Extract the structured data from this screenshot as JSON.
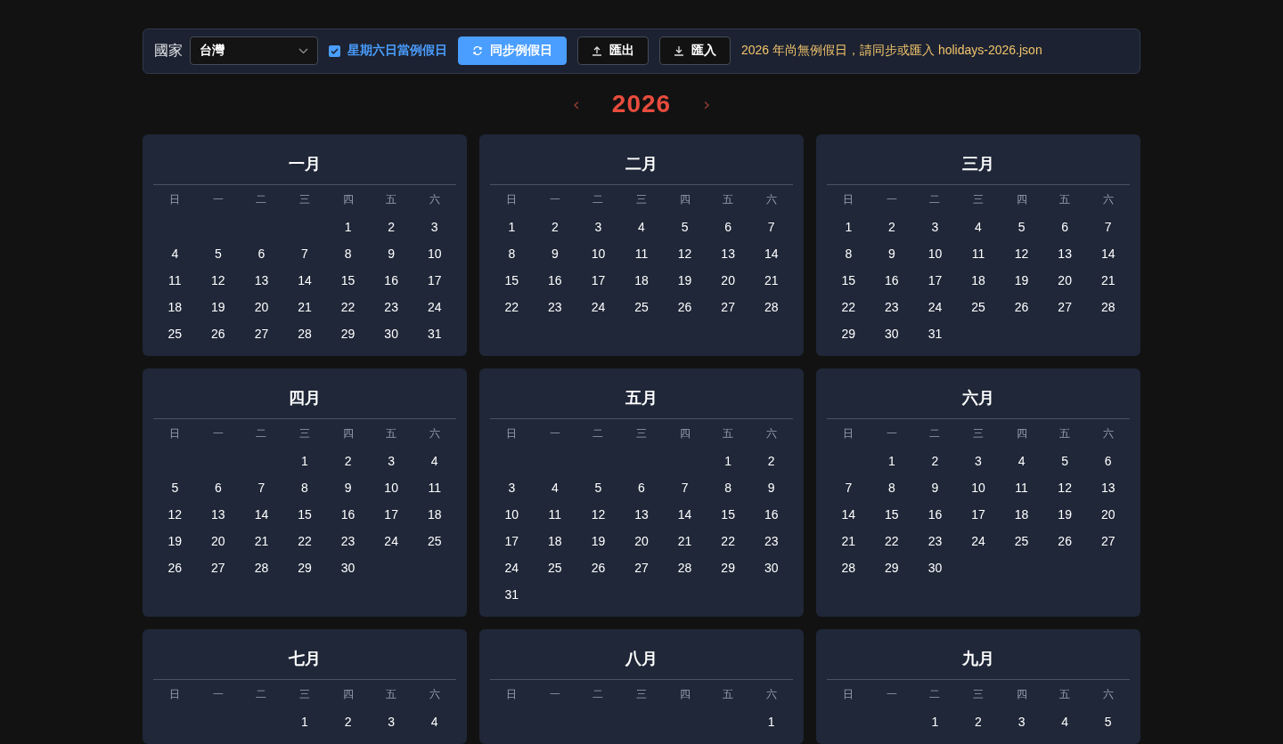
{
  "toolbar": {
    "country_label": "國家",
    "country_select": {
      "value": "台灣"
    },
    "weekend_checkbox": {
      "label": "星期六日當例假日",
      "checked": true
    },
    "buttons": [
      {
        "kind": "sync",
        "label": "同步例假日"
      },
      {
        "kind": "export",
        "label": "匯出"
      },
      {
        "kind": "import",
        "label": "匯入"
      }
    ],
    "notice": "2026 年尚無例假日，請同步或匯入 holidays-2026.json"
  },
  "year_nav": {
    "prev": "‹",
    "year": "2026",
    "next": "›"
  },
  "months": [
    {
      "title": "一月",
      "weekdays": [
        "日",
        "一",
        "二",
        "三",
        "四",
        "五",
        "六"
      ],
      "weeks": [
        {
          "kind": "lead",
          "days": [
            "1",
            "2",
            "3"
          ]
        },
        {
          "kind": "row",
          "days": [
            "4",
            "5",
            "6",
            "7",
            "8",
            "9",
            "10"
          ]
        },
        {
          "kind": "row",
          "days": [
            "11",
            "12",
            "13",
            "14",
            "15",
            "16",
            "17"
          ]
        },
        {
          "kind": "row",
          "days": [
            "18",
            "19",
            "20",
            "21",
            "22",
            "23",
            "24"
          ]
        },
        {
          "kind": "row",
          "days": [
            "25",
            "26",
            "27",
            "28",
            "29",
            "30",
            "31"
          ]
        }
      ]
    },
    {
      "title": "二月",
      "weekdays": [
        "日",
        "一",
        "二",
        "三",
        "四",
        "五",
        "六"
      ],
      "weeks": [
        {
          "kind": "row",
          "days": [
            "1",
            "2",
            "3",
            "4",
            "5",
            "6",
            "7"
          ]
        },
        {
          "kind": "row",
          "days": [
            "8",
            "9",
            "10",
            "11",
            "12",
            "13",
            "14"
          ]
        },
        {
          "kind": "row",
          "days": [
            "15",
            "16",
            "17",
            "18",
            "19",
            "20",
            "21"
          ]
        },
        {
          "kind": "row",
          "days": [
            "22",
            "23",
            "24",
            "25",
            "26",
            "27",
            "28"
          ]
        }
      ]
    },
    {
      "title": "三月",
      "weekdays": [
        "日",
        "一",
        "二",
        "三",
        "四",
        "五",
        "六"
      ],
      "weeks": [
        {
          "kind": "row",
          "days": [
            "1",
            "2",
            "3",
            "4",
            "5",
            "6",
            "7"
          ]
        },
        {
          "kind": "row",
          "days": [
            "8",
            "9",
            "10",
            "11",
            "12",
            "13",
            "14"
          ]
        },
        {
          "kind": "row",
          "days": [
            "15",
            "16",
            "17",
            "18",
            "19",
            "20",
            "21"
          ]
        },
        {
          "kind": "row",
          "days": [
            "22",
            "23",
            "24",
            "25",
            "26",
            "27",
            "28"
          ]
        },
        {
          "kind": "row",
          "days": [
            "29",
            "30",
            "31"
          ]
        }
      ]
    },
    {
      "title": "四月",
      "weekdays": [
        "日",
        "一",
        "二",
        "三",
        "四",
        "五",
        "六"
      ],
      "weeks": [
        {
          "kind": "lead",
          "days": [
            "1",
            "2",
            "3",
            "4"
          ]
        },
        {
          "kind": "row",
          "days": [
            "5",
            "6",
            "7",
            "8",
            "9",
            "10",
            "11"
          ]
        },
        {
          "kind": "row",
          "days": [
            "12",
            "13",
            "14",
            "15",
            "16",
            "17",
            "18"
          ]
        },
        {
          "kind": "row",
          "days": [
            "19",
            "20",
            "21",
            "22",
            "23",
            "24",
            "25"
          ]
        },
        {
          "kind": "row",
          "days": [
            "26",
            "27",
            "28",
            "29",
            "30"
          ]
        }
      ]
    },
    {
      "title": "五月",
      "weekdays": [
        "日",
        "一",
        "二",
        "三",
        "四",
        "五",
        "六"
      ],
      "weeks": [
        {
          "kind": "lead",
          "days": [
            "1",
            "2"
          ]
        },
        {
          "kind": "row",
          "days": [
            "3",
            "4",
            "5",
            "6",
            "7",
            "8",
            "9"
          ]
        },
        {
          "kind": "row",
          "days": [
            "10",
            "11",
            "12",
            "13",
            "14",
            "15",
            "16"
          ]
        },
        {
          "kind": "row",
          "days": [
            "17",
            "18",
            "19",
            "20",
            "21",
            "22",
            "23"
          ]
        },
        {
          "kind": "row",
          "days": [
            "24",
            "25",
            "26",
            "27",
            "28",
            "29",
            "30"
          ]
        },
        {
          "kind": "row",
          "days": [
            "31"
          ]
        }
      ]
    },
    {
      "title": "六月",
      "weekdays": [
        "日",
        "一",
        "二",
        "三",
        "四",
        "五",
        "六"
      ],
      "weeks": [
        {
          "kind": "lead",
          "days": [
            "1",
            "2",
            "3",
            "4",
            "5",
            "6"
          ]
        },
        {
          "kind": "row",
          "days": [
            "7",
            "8",
            "9",
            "10",
            "11",
            "12",
            "13"
          ]
        },
        {
          "kind": "row",
          "days": [
            "14",
            "15",
            "16",
            "17",
            "18",
            "19",
            "20"
          ]
        },
        {
          "kind": "row",
          "days": [
            "21",
            "22",
            "23",
            "24",
            "25",
            "26",
            "27"
          ]
        },
        {
          "kind": "row",
          "days": [
            "28",
            "29",
            "30"
          ]
        }
      ]
    },
    {
      "title": "七月",
      "weekdays": [
        "日",
        "一",
        "二",
        "三",
        "四",
        "五",
        "六"
      ],
      "weeks": [
        {
          "kind": "lead",
          "days": [
            "1",
            "2",
            "3",
            "4"
          ]
        }
      ]
    },
    {
      "title": "八月",
      "weekdays": [
        "日",
        "一",
        "二",
        "三",
        "四",
        "五",
        "六"
      ],
      "weeks": [
        {
          "kind": "lead",
          "days": [
            "1"
          ]
        }
      ]
    },
    {
      "title": "九月",
      "weekdays": [
        "日",
        "一",
        "二",
        "三",
        "四",
        "五",
        "六"
      ],
      "weeks": [
        {
          "kind": "lead",
          "days": [
            "1",
            "2",
            "3",
            "4",
            "5"
          ]
        }
      ]
    }
  ]
}
